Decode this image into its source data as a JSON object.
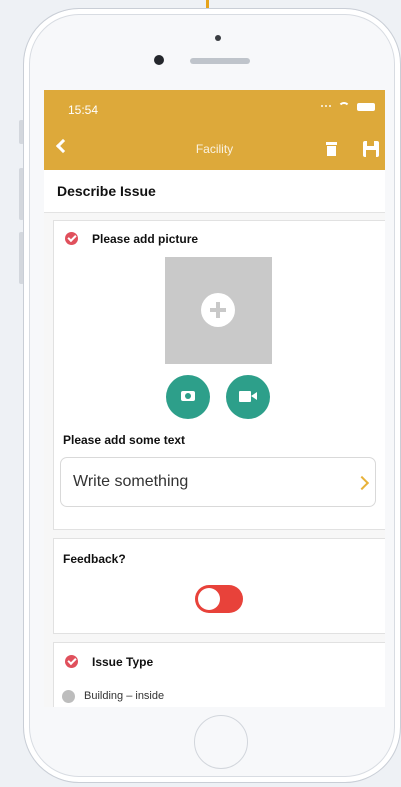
{
  "status_bar": {
    "time": "15:54"
  },
  "nav": {
    "title": "Facility"
  },
  "page": {
    "section_title": "Describe Issue"
  },
  "picture_card": {
    "label": "Please add picture",
    "text_label": "Please add some text",
    "text_field_placeholder": "Write something"
  },
  "feedback_card": {
    "label": "Feedback?",
    "toggle_on": true
  },
  "issue_type_card": {
    "label": "Issue Type",
    "options": [
      "Building – inside"
    ]
  },
  "colors": {
    "header": "#dda93a",
    "action_button": "#2d9f8a",
    "toggle": "#e8423a",
    "required_check": "#e0505c",
    "chevron": "#e8b23a"
  }
}
